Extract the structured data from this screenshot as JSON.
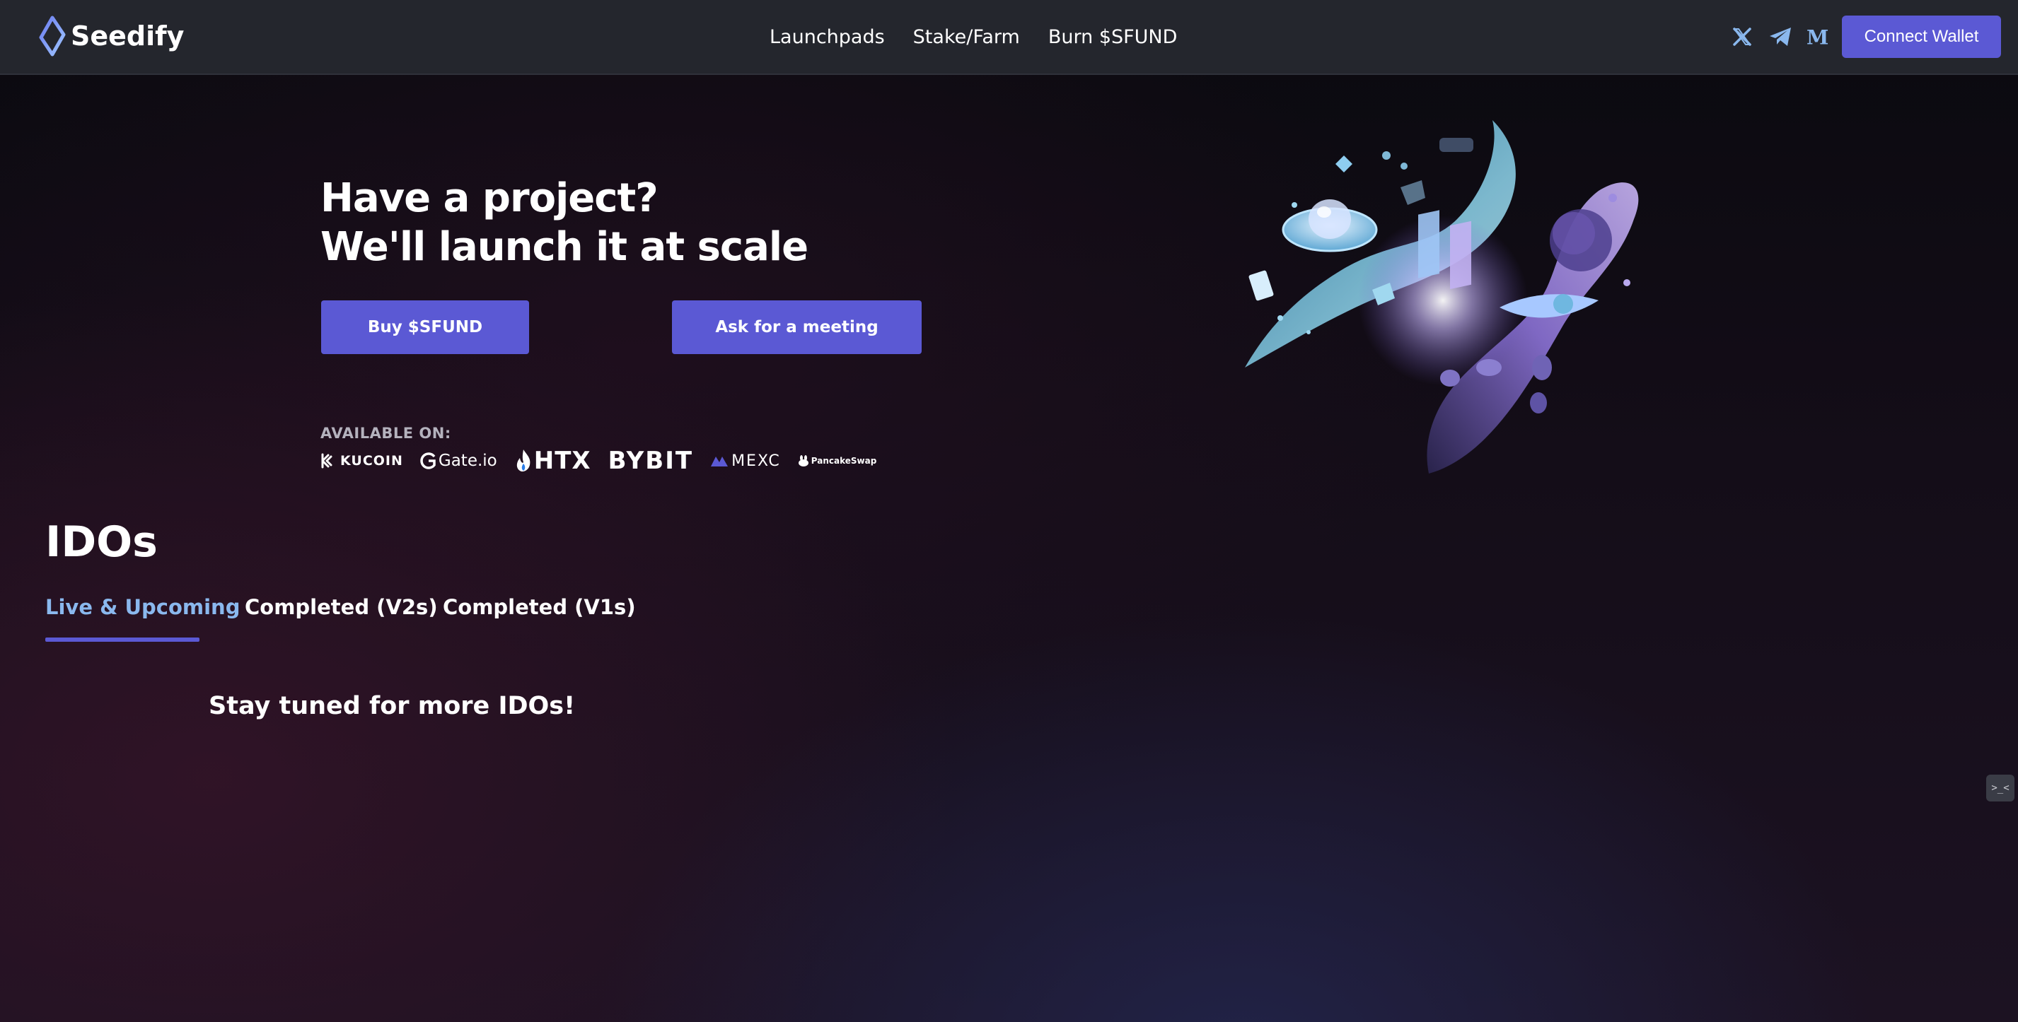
{
  "brand": {
    "name": "Seedify",
    "accent": "#5b59d4",
    "nav_bg": "#24262d",
    "active_tab": "#8ab8ee"
  },
  "nav": {
    "links": [
      "Launchpads",
      "Stake/Farm",
      "Burn $SFUND"
    ],
    "social_icons": [
      "x-icon",
      "telegram-icon",
      "medium-icon"
    ],
    "connect_label": "Connect Wallet"
  },
  "hero": {
    "title_line1": "Have a project?",
    "title_line2": "We'll launch it at scale",
    "buy_label": "Buy $SFUND",
    "meeting_label": "Ask for a meeting",
    "available_label": "AVAILABLE ON:",
    "exchanges": [
      "KUCOIN",
      "Gate.io",
      "HTX",
      "BYBIT",
      "MEXC",
      "PancakeSwap"
    ]
  },
  "idos": {
    "title": "IDOs",
    "tabs": [
      "Live & Upcoming",
      "Completed (V2s)",
      "Completed (V1s)"
    ],
    "active_tab_index": 0,
    "empty_message": "Stay tuned for more IDOs!"
  },
  "widget": {
    "glyph": ">_<"
  }
}
